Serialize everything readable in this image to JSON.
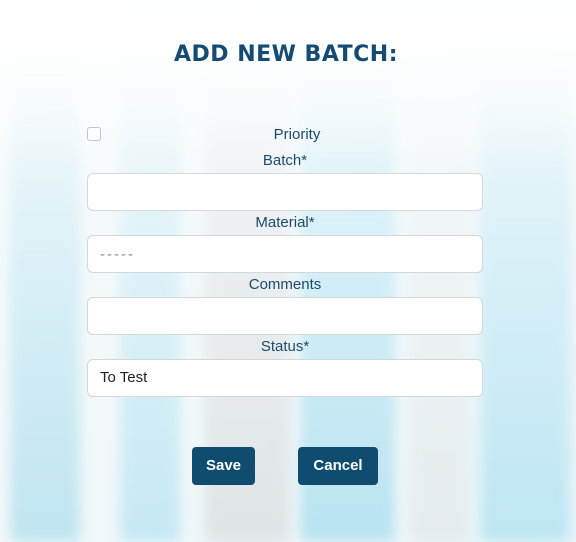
{
  "title": "ADD NEW BATCH:",
  "priority": {
    "label": "Priority",
    "checked": false
  },
  "fields": {
    "batch": {
      "label": "Batch*",
      "value": ""
    },
    "material": {
      "label": "Material*",
      "placeholder": "-----"
    },
    "comments": {
      "label": "Comments",
      "value": ""
    },
    "status": {
      "label": "Status*",
      "value": "To Test"
    }
  },
  "buttons": {
    "save": "Save",
    "cancel": "Cancel"
  },
  "colors": {
    "primary": "#0f4c70",
    "title": "#154a73",
    "label": "#1d4a6b"
  }
}
